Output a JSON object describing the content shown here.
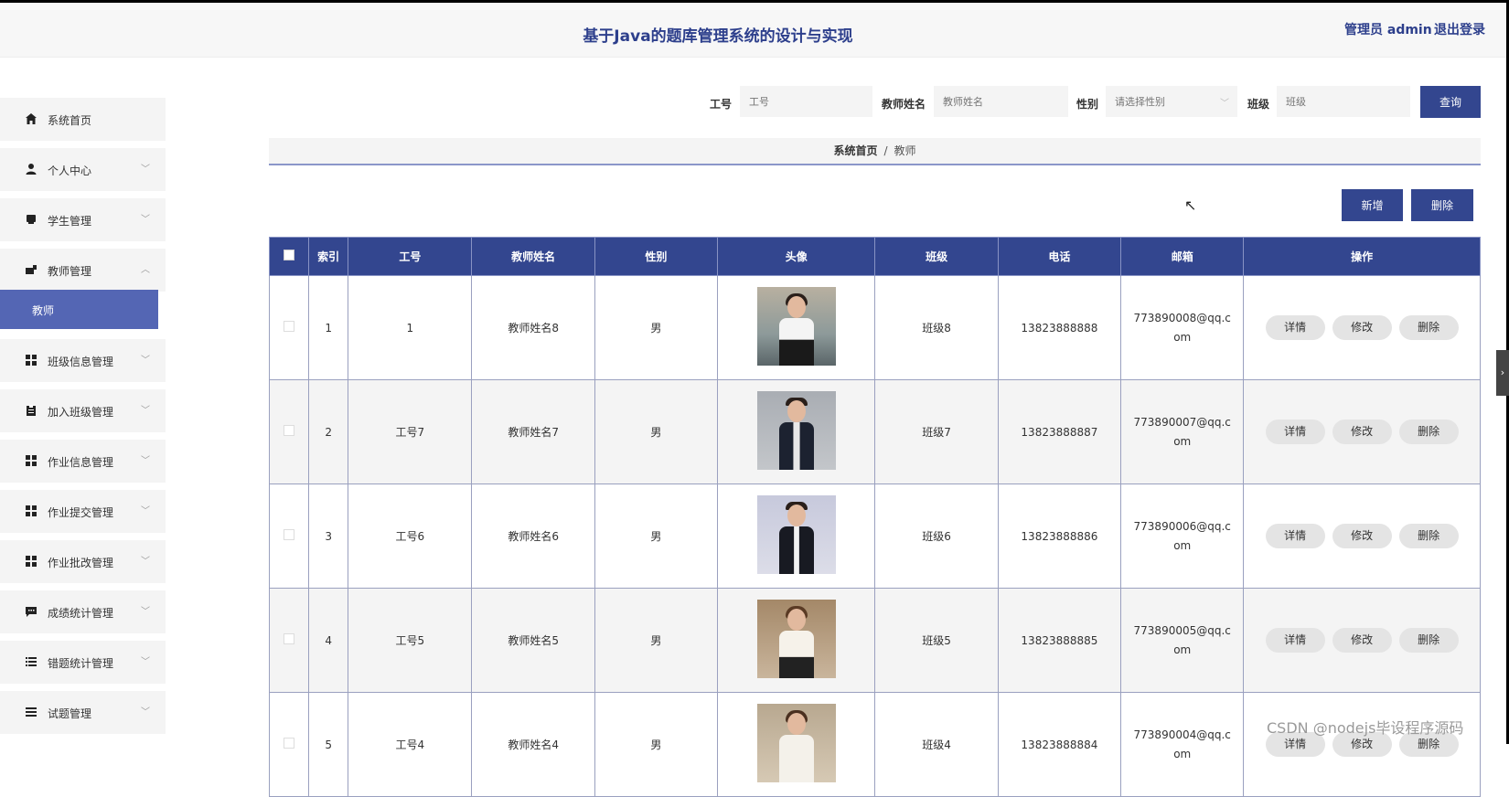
{
  "header": {
    "title": "基于Java的题库管理系统的设计与实现",
    "user": "管理员 admin",
    "logout": "退出登录"
  },
  "sidebar": {
    "items": [
      {
        "label": "系统首页",
        "icon": "home-icon"
      },
      {
        "label": "个人中心",
        "icon": "user-icon"
      },
      {
        "label": "学生管理",
        "icon": "student-icon"
      },
      {
        "label": "教师管理",
        "icon": "teacher-icon"
      },
      {
        "label": "班级信息管理",
        "icon": "grid-icon"
      },
      {
        "label": "加入班级管理",
        "icon": "clipboard-icon"
      },
      {
        "label": "作业信息管理",
        "icon": "grid-icon"
      },
      {
        "label": "作业提交管理",
        "icon": "grid-icon"
      },
      {
        "label": "作业批改管理",
        "icon": "grid-icon"
      },
      {
        "label": "成绩统计管理",
        "icon": "chat-icon"
      },
      {
        "label": "错题统计管理",
        "icon": "list-icon"
      },
      {
        "label": "试题管理",
        "icon": "list-icon"
      }
    ],
    "active_sub": "教师"
  },
  "search": {
    "id_label": "工号",
    "id_placeholder": "工号",
    "name_label": "教师姓名",
    "name_placeholder": "教师姓名",
    "gender_label": "性别",
    "gender_placeholder": "请选择性别",
    "class_label": "班级",
    "class_placeholder": "班级",
    "query": "查询"
  },
  "breadcrumb": {
    "home": "系统首页",
    "sep": "/",
    "current": "教师"
  },
  "actions": {
    "add": "新增",
    "delete": "删除"
  },
  "table": {
    "headers": [
      "索引",
      "工号",
      "教师姓名",
      "性别",
      "头像",
      "班级",
      "电话",
      "邮箱",
      "操作"
    ],
    "rows": [
      {
        "index": "1",
        "id": "1",
        "name": "教师姓名8",
        "gender": "男",
        "class": "班级8",
        "phone": "13823888888",
        "email": "773890008@qq.com",
        "avatar": "female-teacher-photo"
      },
      {
        "index": "2",
        "id": "工号7",
        "name": "教师姓名7",
        "gender": "男",
        "class": "班级7",
        "phone": "13823888887",
        "email": "773890007@qq.com",
        "avatar": "male-teacher-photo"
      },
      {
        "index": "3",
        "id": "工号6",
        "name": "教师姓名6",
        "gender": "男",
        "class": "班级6",
        "phone": "13823888886",
        "email": "773890006@qq.com",
        "avatar": "male-teacher-photo"
      },
      {
        "index": "4",
        "id": "工号5",
        "name": "教师姓名5",
        "gender": "男",
        "class": "班级5",
        "phone": "13823888885",
        "email": "773890005@qq.com",
        "avatar": "female-teacher-photo"
      },
      {
        "index": "5",
        "id": "工号4",
        "name": "教师姓名4",
        "gender": "男",
        "class": "班级4",
        "phone": "13823888884",
        "email": "773890004@qq.com",
        "avatar": "female-teacher-photo"
      }
    ],
    "ops": {
      "detail": "详情",
      "edit": "修改",
      "delete": "删除"
    }
  },
  "watermark": "CSDN @nodejs毕设程序源码",
  "colors": {
    "primary": "#33468f",
    "active_menu": "#5466b4",
    "title": "#2d3f8c"
  }
}
